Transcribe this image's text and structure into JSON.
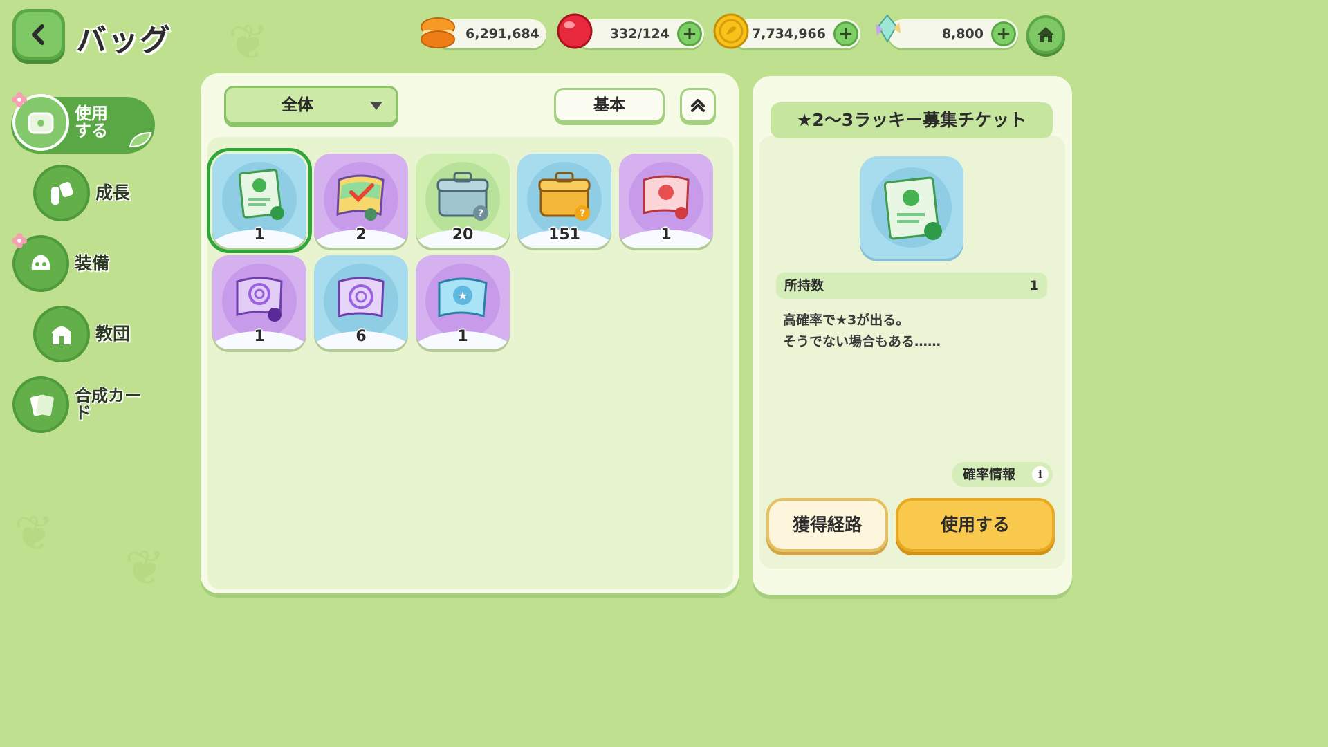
{
  "header": {
    "title": "バッグ"
  },
  "currencies": [
    {
      "name": "macaron",
      "icon": "macaron-icon",
      "value": "6,291,684",
      "has_plus": false,
      "color": "#f28a1c"
    },
    {
      "name": "gem",
      "icon": "red-gem-icon",
      "value": "332/124",
      "has_plus": true,
      "color": "#e8283c"
    },
    {
      "name": "coin",
      "icon": "gold-coin-icon",
      "value": "7,734,966",
      "has_plus": true,
      "color": "#f2b90f"
    },
    {
      "name": "crystal",
      "icon": "rainbow-crystal-icon",
      "value": "8,800",
      "has_plus": true,
      "color": "#8fd6e8"
    }
  ],
  "sidebar": {
    "items": [
      {
        "label": "使用する",
        "icon": "chest-icon",
        "active": true,
        "badge": true
      },
      {
        "label": "成長",
        "icon": "potion-icon",
        "active": false,
        "badge": false
      },
      {
        "label": "装備",
        "icon": "outfit-icon",
        "active": false,
        "badge": true
      },
      {
        "label": "教団",
        "icon": "temple-icon",
        "active": false,
        "badge": false
      },
      {
        "label": "合成カード",
        "icon": "card-icon",
        "active": false,
        "badge": false
      }
    ]
  },
  "filter": {
    "category": "全体",
    "sort": "基本"
  },
  "items": [
    {
      "kind": "green-ticket",
      "bg": "blue",
      "qty": "1",
      "selected": true
    },
    {
      "kind": "rainbow-ticket",
      "bg": "purple",
      "qty": "2",
      "selected": false
    },
    {
      "kind": "silver-box",
      "bg": "green",
      "qty": "20",
      "selected": false
    },
    {
      "kind": "gold-box",
      "bg": "blue",
      "qty": "151",
      "selected": false
    },
    {
      "kind": "red-ticket",
      "bg": "purple",
      "qty": "1",
      "selected": false
    },
    {
      "kind": "purple-swirl-ticket",
      "bg": "purple",
      "qty": "1",
      "selected": false
    },
    {
      "kind": "swirl-ticket",
      "bg": "blue",
      "qty": "6",
      "selected": false
    },
    {
      "kind": "blue-star-ticket",
      "bg": "purple",
      "qty": "1",
      "selected": false
    }
  ],
  "detail": {
    "title": "★2～3ラッキー募集チケット",
    "owned_label": "所持数",
    "owned_value": "1",
    "description_line1": "高確率で★3が出る。",
    "description_line2": "そうでない場合もある……",
    "prob_label": "確率情報",
    "route_label": "獲得経路",
    "use_label": "使用する"
  }
}
